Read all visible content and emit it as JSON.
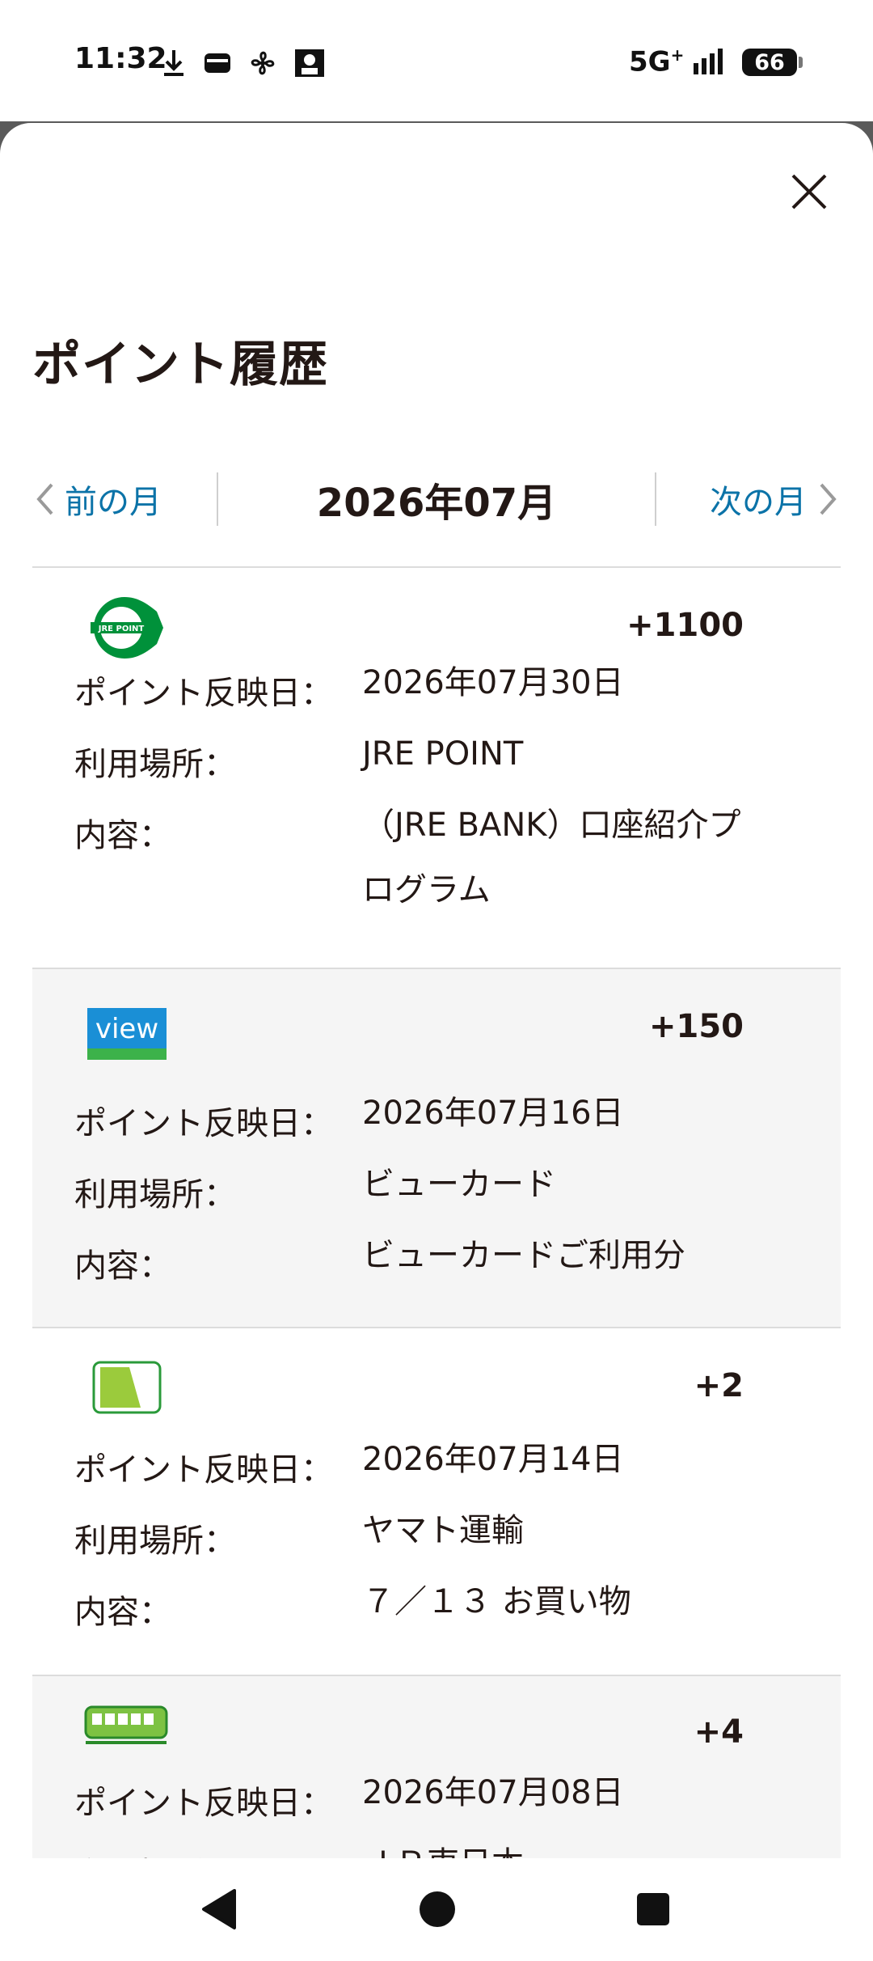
{
  "status_bar": {
    "time": "11:32",
    "network": "5G",
    "network_sup": "+",
    "battery": "66",
    "icons": [
      "download-icon",
      "wallet-icon",
      "fan-icon",
      "face-grid-icon",
      "signal-icon"
    ]
  },
  "sheet": {
    "close_icon": "close-icon",
    "title": "ポイント履歴"
  },
  "month_nav": {
    "prev_label": "前の月",
    "current": "2026年07月",
    "next_label": "次の月"
  },
  "labels": {
    "date": "ポイント反映日：",
    "place": "利用場所：",
    "content": "内容："
  },
  "entries": [
    {
      "icon": "jre-point-logo",
      "points": "+1100",
      "date": "2026年07月30日",
      "place": "JRE POINT",
      "content": "（JRE BANK）口座紹介プログラム",
      "logo_text": "JRE POINT"
    },
    {
      "icon": "view-card-logo",
      "points": "+150",
      "date": "2026年07月16日",
      "place": "ビューカード",
      "content": "ビューカードご利用分",
      "logo_text": "view"
    },
    {
      "icon": "card-icon",
      "points": "+2",
      "date": "2026年07月14日",
      "place": "ヤマト運輸",
      "content": "７／１３ お買い物"
    },
    {
      "icon": "train-icon",
      "points": "+4",
      "date": "2026年07月08日",
      "place": "ＪＲ東日本",
      "content": ""
    }
  ],
  "colors": {
    "link": "#0b73a8",
    "jre_green": "#00913a",
    "view_blue": "#1a8fd6",
    "train_green": "#7dc242"
  },
  "nav_bar": {
    "back_icon": "back-icon",
    "home_icon": "home-icon",
    "recents_icon": "recents-icon"
  }
}
